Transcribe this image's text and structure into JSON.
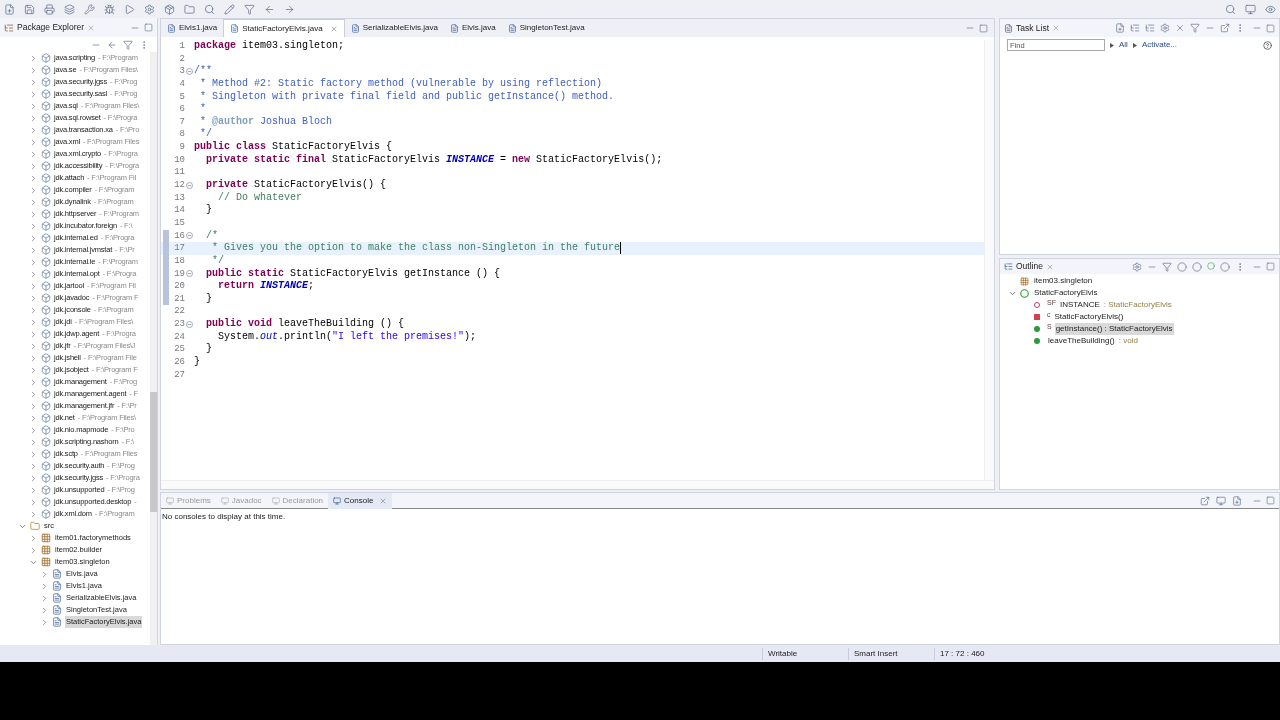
{
  "editor_tabs": [
    {
      "label": "Elvis1.java",
      "selected": false
    },
    {
      "label": "StaticFactoryElvis.java",
      "selected": true
    },
    {
      "label": "SerializableElvis.java",
      "selected": false
    },
    {
      "label": "Elvis.java",
      "selected": false
    },
    {
      "label": "SingletonTest.java",
      "selected": false
    }
  ],
  "package_explorer": {
    "title": "Package Explorer",
    "library_items": [
      {
        "name": "java.scripting",
        "path": "- F:\\Program"
      },
      {
        "name": "java.se",
        "path": "- F:\\Program Files\\"
      },
      {
        "name": "java.security.jgss",
        "path": "- F:\\Prog"
      },
      {
        "name": "java.security.sasl",
        "path": "- F:\\Prog"
      },
      {
        "name": "java.sql",
        "path": "- F:\\Program Files\\"
      },
      {
        "name": "java.sql.rowset",
        "path": "- F:\\Progra"
      },
      {
        "name": "java.transaction.xa",
        "path": "- F:\\Pro"
      },
      {
        "name": "java.xml",
        "path": "- F:\\Program Files"
      },
      {
        "name": "java.xml.crypto",
        "path": "- F:\\Progra"
      },
      {
        "name": "jdk.accessibility",
        "path": "- F:\\Progra"
      },
      {
        "name": "jdk.attach",
        "path": "- F:\\Program Fil"
      },
      {
        "name": "jdk.compiler",
        "path": "- F:\\Program"
      },
      {
        "name": "jdk.dynalink",
        "path": "- F:\\Program"
      },
      {
        "name": "jdk.httpserver",
        "path": "- F:\\Program"
      },
      {
        "name": "jdk.incubator.foreign",
        "path": "- F:\\"
      },
      {
        "name": "jdk.internal.ed",
        "path": "- F:\\Progra"
      },
      {
        "name": "jdk.internal.jvmstat",
        "path": "- F:\\Pr"
      },
      {
        "name": "jdk.internal.le",
        "path": "- F:\\Program"
      },
      {
        "name": "jdk.internal.opt",
        "path": "- F:\\Progra"
      },
      {
        "name": "jdk.jartool",
        "path": "- F:\\Program Fil"
      },
      {
        "name": "jdk.javadoc",
        "path": "- F:\\Program F"
      },
      {
        "name": "jdk.jconsole",
        "path": "- F:\\Program"
      },
      {
        "name": "jdk.jdi",
        "path": "- F:\\Program Files\\"
      },
      {
        "name": "jdk.jdwp.agent",
        "path": "- F:\\Progra"
      },
      {
        "name": "jdk.jfr",
        "path": "- F:\\Program Files\\J"
      },
      {
        "name": "jdk.jshell",
        "path": "- F:\\Program File"
      },
      {
        "name": "jdk.jsobject",
        "path": "- F:\\Program F"
      },
      {
        "name": "jdk.management",
        "path": "- F:\\Prog"
      },
      {
        "name": "jdk.management.agent",
        "path": "- F"
      },
      {
        "name": "jdk.management.jfr",
        "path": "- F:\\Pr"
      },
      {
        "name": "jdk.net",
        "path": "- F:\\Program Files\\"
      },
      {
        "name": "jdk.nio.mapmode",
        "path": "- F:\\Pro"
      },
      {
        "name": "jdk.scripting.nashorn",
        "path": "- F:\\"
      },
      {
        "name": "jdk.sctp",
        "path": "- F:\\Program Files"
      },
      {
        "name": "jdk.security.auth",
        "path": "- F:\\Prog"
      },
      {
        "name": "jdk.security.jgss",
        "path": "- F:\\Progra"
      },
      {
        "name": "jdk.unsupported",
        "path": "- F:\\Prog"
      },
      {
        "name": "jdk.unsupported.desktop",
        "path": "-"
      },
      {
        "name": "jdk.xml.dom",
        "path": "- F:\\Program"
      }
    ],
    "tree": [
      {
        "kind": "source-folder",
        "label": "src",
        "expanded": true,
        "selected": false,
        "children": [
          {
            "kind": "package",
            "label": "item01.factorymethods",
            "expanded": false,
            "selected": false
          },
          {
            "kind": "package",
            "label": "item02.builder",
            "expanded": false,
            "selected": false
          },
          {
            "kind": "package",
            "label": "item03.singleton",
            "expanded": true,
            "selected": false,
            "children": [
              {
                "kind": "file",
                "label": "Elvis.java",
                "expanded": false,
                "selected": false
              },
              {
                "kind": "file",
                "label": "Elvis1.java",
                "expanded": false,
                "selected": false
              },
              {
                "kind": "file",
                "label": "SerializableElvis.java",
                "expanded": false,
                "selected": false
              },
              {
                "kind": "file",
                "label": "SingletonTest.java",
                "expanded": false,
                "selected": false
              },
              {
                "kind": "file",
                "label": "StaticFactoryElvis.java",
                "expanded": false,
                "selected": true
              }
            ]
          }
        ]
      }
    ]
  },
  "code_lines": [
    {
      "n": "1",
      "fold": false,
      "changed": false,
      "current": false,
      "tokens": [
        {
          "kind": "keyword",
          "text": "package"
        },
        {
          "kind": "plain",
          "text": " item03.singleton;"
        }
      ]
    },
    {
      "n": "2",
      "fold": false,
      "changed": false,
      "current": false
    },
    {
      "n": "3",
      "fold": true,
      "changed": false,
      "current": false,
      "tokens": [
        {
          "kind": "doc",
          "text": "/**"
        }
      ]
    },
    {
      "n": "4",
      "fold": false,
      "changed": false,
      "current": false,
      "tokens": [
        {
          "kind": "doc",
          "text": " * Method #2: Static factory method (vulnerable by using reflection)"
        }
      ]
    },
    {
      "n": "5",
      "fold": false,
      "changed": false,
      "current": false,
      "tokens": [
        {
          "kind": "doc",
          "text": " * Singleton with private final field and public getInstance() method."
        }
      ]
    },
    {
      "n": "6",
      "fold": false,
      "changed": false,
      "current": false,
      "tokens": [
        {
          "kind": "doc",
          "text": " *"
        }
      ]
    },
    {
      "n": "7",
      "fold": false,
      "changed": false,
      "current": false,
      "tokens": [
        {
          "kind": "doc",
          "text": " * "
        },
        {
          "kind": "tag",
          "text": "@author"
        },
        {
          "kind": "doc",
          "text": " Joshua Bloch"
        }
      ]
    },
    {
      "n": "8",
      "fold": false,
      "changed": false,
      "current": false,
      "tokens": [
        {
          "kind": "doc",
          "text": " */"
        }
      ]
    },
    {
      "n": "9",
      "fold": false,
      "changed": false,
      "current": false,
      "tokens": [
        {
          "kind": "keyword",
          "text": "public class"
        },
        {
          "kind": "plain",
          "text": " StaticFactoryElvis {"
        }
      ]
    },
    {
      "n": "10",
      "fold": false,
      "changed": false,
      "current": false,
      "tokens": [
        {
          "kind": "keyword",
          "text": "  private static final"
        },
        {
          "kind": "plain",
          "text": " StaticFactoryElvis "
        },
        {
          "kind": "field",
          "text": "INSTANCE"
        },
        {
          "kind": "plain",
          "text": " = "
        },
        {
          "kind": "keyword",
          "text": "new"
        },
        {
          "kind": "plain",
          "text": " StaticFactoryElvis();"
        }
      ]
    },
    {
      "n": "11",
      "fold": false,
      "changed": false,
      "current": false
    },
    {
      "n": "12",
      "fold": true,
      "changed": false,
      "current": false,
      "tokens": [
        {
          "kind": "keyword",
          "text": "  private"
        },
        {
          "kind": "plain",
          "text": " StaticFactoryElvis() {"
        }
      ]
    },
    {
      "n": "13",
      "fold": false,
      "changed": false,
      "current": false,
      "tokens": [
        {
          "kind": "comment",
          "text": "    // Do whatever"
        }
      ]
    },
    {
      "n": "14",
      "fold": false,
      "changed": false,
      "current": false,
      "tokens": [
        {
          "kind": "plain",
          "text": "  }"
        }
      ]
    },
    {
      "n": "15",
      "fold": false,
      "changed": false,
      "current": false
    },
    {
      "n": "16",
      "fold": true,
      "changed": true,
      "current": false,
      "tokens": [
        {
          "kind": "comment",
          "text": "  /*"
        }
      ]
    },
    {
      "n": "17",
      "fold": false,
      "changed": true,
      "current": true,
      "tokens": [
        {
          "kind": "comment",
          "text": "   * Gives you the option to make the class non-Singleton in the future"
        }
      ]
    },
    {
      "n": "18",
      "fold": false,
      "changed": true,
      "current": false,
      "tokens": [
        {
          "kind": "comment",
          "text": "   */"
        }
      ]
    },
    {
      "n": "19",
      "fold": true,
      "changed": true,
      "current": false,
      "tokens": [
        {
          "kind": "keyword",
          "text": "  public static"
        },
        {
          "kind": "plain",
          "text": " StaticFactoryElvis getInstance () {"
        }
      ]
    },
    {
      "n": "20",
      "fold": false,
      "changed": true,
      "current": false,
      "tokens": [
        {
          "kind": "keyword",
          "text": "    return"
        },
        {
          "kind": "field",
          "text": " INSTANCE"
        },
        {
          "kind": "plain",
          "text": ";"
        }
      ]
    },
    {
      "n": "21",
      "fold": false,
      "changed": true,
      "current": false,
      "tokens": [
        {
          "kind": "plain",
          "text": "  }"
        }
      ]
    },
    {
      "n": "22",
      "fold": false,
      "changed": false,
      "current": false
    },
    {
      "n": "23",
      "fold": true,
      "changed": false,
      "current": false,
      "tokens": [
        {
          "kind": "keyword",
          "text": "  public void"
        },
        {
          "kind": "plain",
          "text": " leaveTheBuilding () {"
        }
      ]
    },
    {
      "n": "24",
      "fold": false,
      "changed": false,
      "current": false,
      "tokens": [
        {
          "kind": "plain",
          "text": "    System."
        },
        {
          "kind": "static-field",
          "text": "out"
        },
        {
          "kind": "plain",
          "text": ".println("
        },
        {
          "kind": "string",
          "text": "\"I left the premises!\""
        },
        {
          "kind": "plain",
          "text": ");"
        }
      ]
    },
    {
      "n": "25",
      "fold": false,
      "changed": false,
      "current": false,
      "tokens": [
        {
          "kind": "plain",
          "text": "  }"
        }
      ]
    },
    {
      "n": "26",
      "fold": false,
      "changed": false,
      "current": false,
      "tokens": [
        {
          "kind": "plain",
          "text": "}"
        }
      ]
    },
    {
      "n": "27",
      "fold": false,
      "changed": false,
      "current": false
    }
  ],
  "task_list": {
    "title": "Task List",
    "find_placeholder": "Find",
    "links": [
      "All",
      "Activate..."
    ]
  },
  "outline": {
    "title": "Outline",
    "items": [
      {
        "kind": "package",
        "label": "item03.singleton",
        "selected": false
      },
      {
        "kind": "class",
        "label": "StaticFactoryElvis",
        "selected": false,
        "expanded": true,
        "children": [
          {
            "kind": "field",
            "label": "INSTANCE",
            "modifier": "SF",
            "detail": ": StaticFactoryElvis",
            "selected": false
          },
          {
            "kind": "constructor",
            "label": "StaticFactoryElvis()",
            "modifier": "c",
            "selected": false
          },
          {
            "kind": "method",
            "label": "getInstance() : StaticFactoryElvis",
            "modifier": "S",
            "selected": true
          },
          {
            "kind": "method",
            "label": "leaveTheBuilding()",
            "detail": ": void",
            "selected": false
          }
        ]
      }
    ]
  },
  "bottom_tabs": [
    {
      "label": "Problems",
      "selected": false
    },
    {
      "label": "Javadoc",
      "selected": false
    },
    {
      "label": "Declaration",
      "selected": false
    },
    {
      "label": "Console",
      "selected": true
    }
  ],
  "console_message": "No consoles to display at this time.",
  "status_bar": [
    "Writable",
    "Smart Insert",
    "17 : 72 : 460"
  ]
}
